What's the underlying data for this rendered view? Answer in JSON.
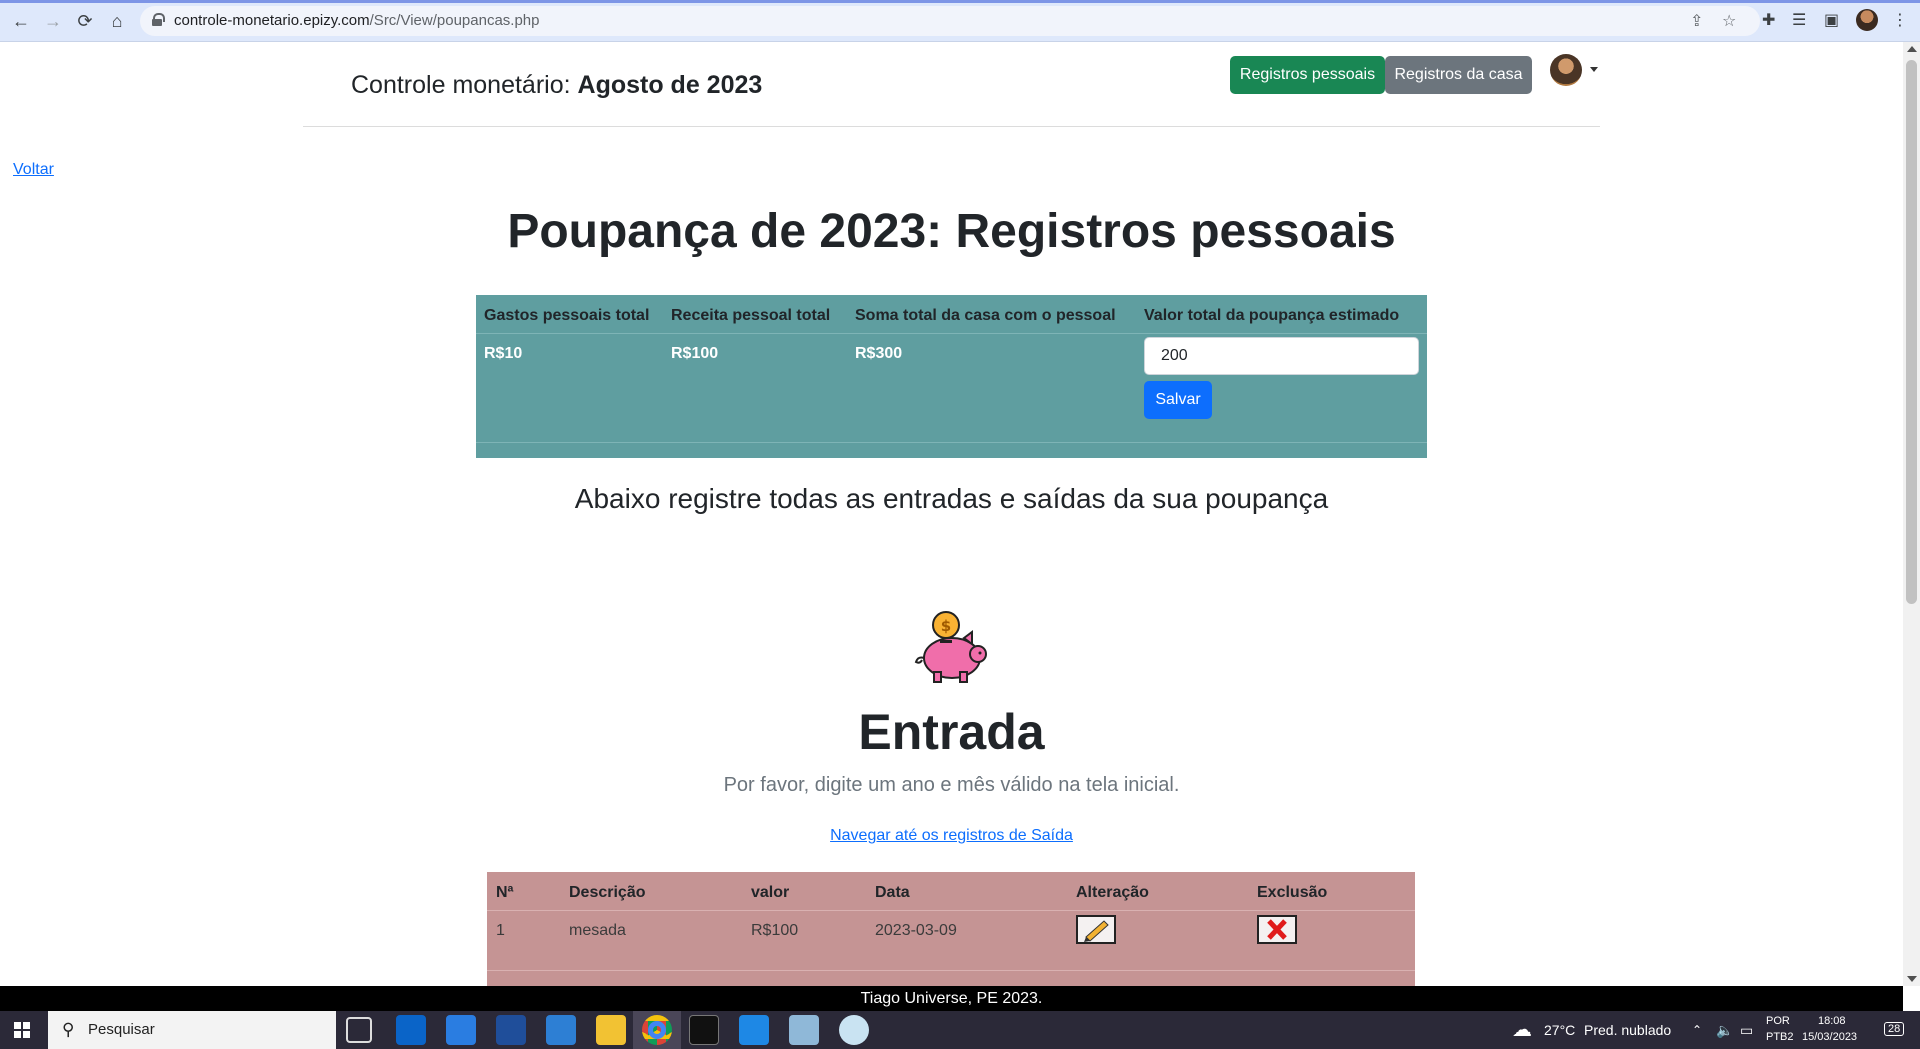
{
  "browser": {
    "url_host": "controle-monetario.epizy.com",
    "url_path": "/Src/View/poupancas.php"
  },
  "header": {
    "title_prefix": "Controle monetário: ",
    "title_period": "Agosto de 2023",
    "btn_personal": "Registros pessoais",
    "btn_house": "Registros da casa"
  },
  "back_link": "Voltar",
  "page_title": "Poupança de 2023: Registros pessoais",
  "summary": {
    "headers": [
      "Gastos pessoais total",
      "Receita pessoal total",
      "Soma total da casa com o pessoal",
      "Valor total da poupança estimado"
    ],
    "values": [
      "R$10",
      "R$100",
      "R$300"
    ],
    "estimate_value": "200",
    "save_label": "Salvar",
    "colors": {
      "background": "#5f9ea0"
    }
  },
  "subtitle": "Abaixo registre todas as entradas e saídas da sua poupança",
  "entry": {
    "heading": "Entrada",
    "message": "Por favor, digite um ano e mês válido na tela inicial.",
    "nav_link": "Navegar até os registros de Saída",
    "headers": [
      "Nª",
      "Descrição",
      "valor",
      "Data",
      "Alteração",
      "Exclusão"
    ],
    "rows": [
      {
        "n": "1",
        "descricao": "mesada",
        "valor": "R$100",
        "data": "2023-03-09"
      }
    ],
    "colors": {
      "background": "#c59494"
    }
  },
  "footer": "Tiago Universe, PE 2023.",
  "taskbar": {
    "search_placeholder": "Pesquisar",
    "weather_temp": "27°C",
    "weather_desc": "Pred. nublado",
    "lang": "POR",
    "layout": "PTB2",
    "time": "18:08",
    "date": "15/03/2023",
    "notifications": "28"
  }
}
